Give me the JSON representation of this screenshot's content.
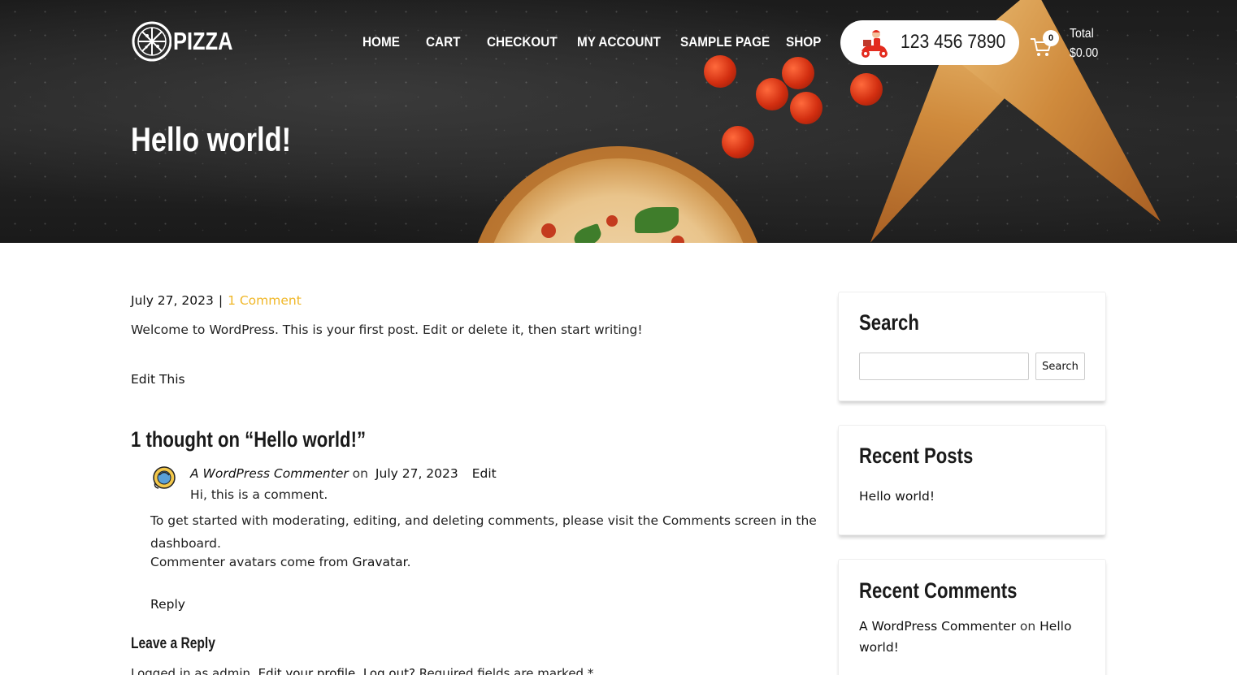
{
  "header": {
    "logo_text": "PIZZA",
    "nav": [
      {
        "label": "HOME"
      },
      {
        "label": "CART"
      },
      {
        "label": "CHECKOUT"
      },
      {
        "label": "MY ACCOUNT"
      },
      {
        "label": "SAMPLE PAGE"
      },
      {
        "label": "SHOP"
      }
    ],
    "phone": "123 456 7890",
    "cart_count": "0",
    "total_label": "Total",
    "total_value": "$0.00"
  },
  "hero": {
    "title": "Hello world!"
  },
  "post": {
    "date": "July 27, 2023",
    "separator": "|",
    "comments_link": "1 Comment",
    "body": "Welcome to WordPress. This is your first post. Edit or delete it, then start writing!",
    "edit_link": "Edit This"
  },
  "comments": {
    "heading": "1 thought on “Hello world!”",
    "items": [
      {
        "author": "A WordPress Commenter",
        "on": "on",
        "date": "July 27, 2023",
        "edit": "Edit",
        "line1": "Hi, this is a comment.",
        "line2": "To get started with moderating, editing, and deleting comments, please visit the Comments screen in the dashboard.",
        "line3_prefix": "Commenter avatars come from ",
        "line3_link": "Gravatar",
        "line3_suffix": ".",
        "reply": "Reply"
      }
    ]
  },
  "reply_form": {
    "heading": "Leave a Reply",
    "logged_in_prefix": "Logged in as admin. ",
    "edit_profile": "Edit your profile",
    "logout": "Log out?",
    "required_text": " Required fields are marked *"
  },
  "sidebar": {
    "search": {
      "title": "Search",
      "input_value": "",
      "button": "Search"
    },
    "recent_posts": {
      "title": "Recent Posts",
      "items": [
        "Hello world!"
      ]
    },
    "recent_comments": {
      "title": "Recent Comments",
      "author": "A WordPress Commenter",
      "on": "on",
      "post": "Hello world!"
    }
  },
  "colors": {
    "accent": "#f0b728",
    "hero_bg": "#222222"
  }
}
